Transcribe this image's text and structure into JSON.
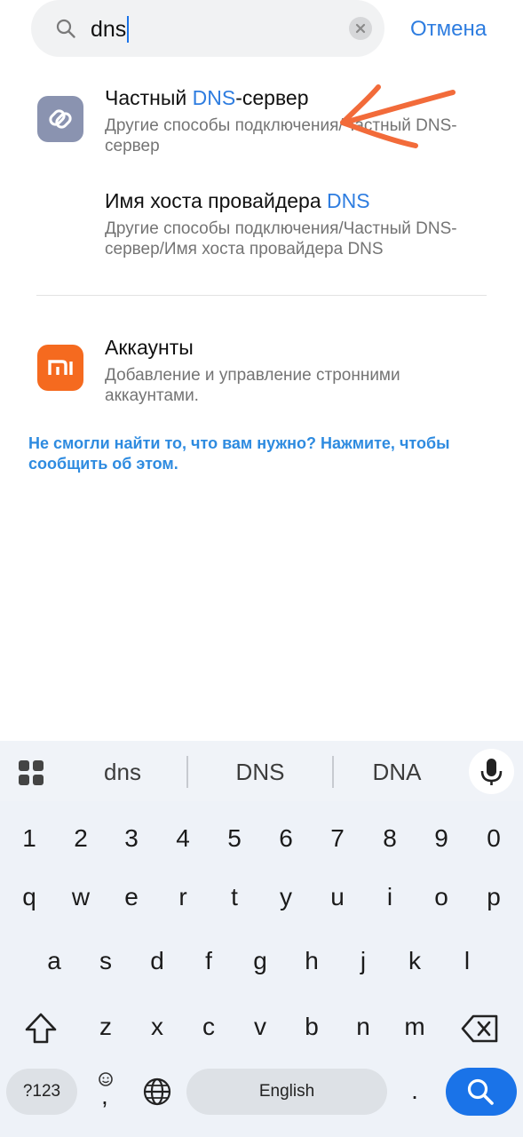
{
  "search": {
    "query": "dns",
    "cancel_label": "Отмена"
  },
  "results": [
    {
      "title_pre": "Частный ",
      "title_hl": "DNS",
      "title_post": "-сервер",
      "subtitle": "Другие способы подключения/Частный DNS-сервер",
      "icon": "link-icon",
      "annotation": "orange-arrow"
    },
    {
      "title_pre": "Имя хоста провайдера ",
      "title_hl": "DNS",
      "title_post": "",
      "subtitle": "Другие способы подключения/Частный DNS-сервер/Имя хоста провайдера DNS"
    },
    {
      "title_pre": "Аккаунты",
      "title_hl": "",
      "title_post": "",
      "subtitle": "Добавление и управление стронними аккаунтами.",
      "icon": "mi-logo-icon"
    }
  ],
  "feedback_link": "Не смогли найти то, что вам нужно? Нажмите, чтобы сообщить об этом.",
  "keyboard": {
    "suggestions": [
      "dns",
      "DNS",
      "DNA"
    ],
    "row_numbers": [
      "1",
      "2",
      "3",
      "4",
      "5",
      "6",
      "7",
      "8",
      "9",
      "0"
    ],
    "row_1": [
      "q",
      "w",
      "e",
      "r",
      "t",
      "y",
      "u",
      "i",
      "o",
      "p"
    ],
    "row_2": [
      "a",
      "s",
      "d",
      "f",
      "g",
      "h",
      "j",
      "k",
      "l"
    ],
    "row_3": [
      "z",
      "x",
      "c",
      "v",
      "b",
      "n",
      "m"
    ],
    "symbols_label": "?123",
    "comma": ",",
    "period": ".",
    "space_label": "English"
  },
  "colors": {
    "accent": "#2e7de0",
    "search_key": "#1a73e8",
    "arrow": "#f26b3a",
    "mi_orange": "#f56a1f",
    "link_icon_bg": "#8a93b0"
  }
}
